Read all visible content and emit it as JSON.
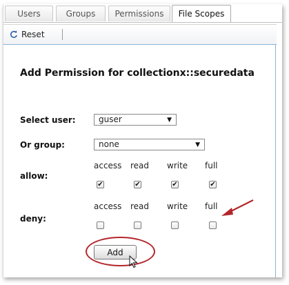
{
  "tabs": [
    {
      "label": "Users",
      "active": false
    },
    {
      "label": "Groups",
      "active": false
    },
    {
      "label": "Permissions",
      "active": false
    },
    {
      "label": "File Scopes",
      "active": true
    }
  ],
  "toolbar": {
    "reset_label": "Reset"
  },
  "form": {
    "heading": "Add Permission for collectionx::securedata",
    "user_label": "Select user:",
    "user_value": "guser",
    "group_label": "Or group:",
    "group_value": "none",
    "allow_label": "allow:",
    "deny_label": "deny:",
    "columns": [
      "access",
      "read",
      "write",
      "full"
    ],
    "allow_checked": [
      true,
      true,
      true,
      true
    ],
    "deny_checked": [
      false,
      false,
      false,
      false
    ],
    "add_label": "Add"
  },
  "colors": {
    "annotation": "#b3262b",
    "panel_border": "#8ab4d8"
  }
}
